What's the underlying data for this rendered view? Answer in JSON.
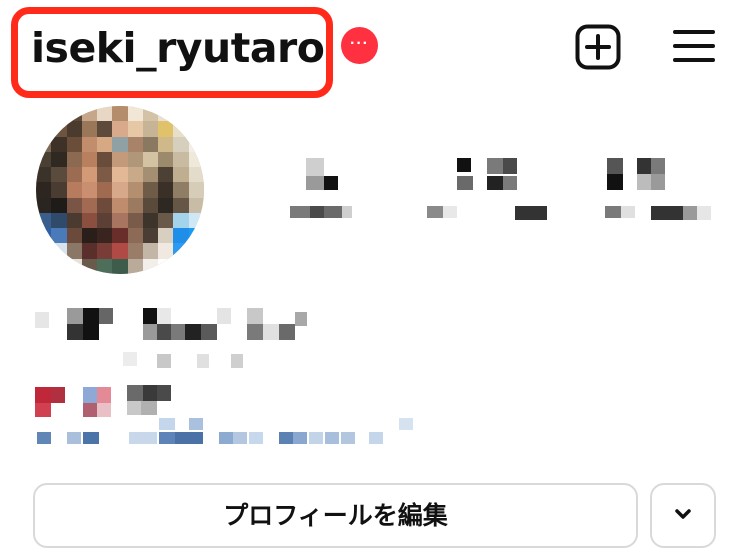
{
  "header": {
    "username": "iseki_ryutaro",
    "notification_dots": "···",
    "create_icon": "plus-square-icon",
    "menu_icon": "hamburger-menu-icon",
    "highlight_color": "#ff2a1a",
    "badge_color": "#ff3040"
  },
  "profile": {
    "avatar": "pixelated-profile-photo",
    "stats_obscured": true,
    "bio_obscured": true
  },
  "actions": {
    "edit_profile_label": "プロフィールを編集",
    "suggest_icon": "chevron-down-icon"
  }
}
